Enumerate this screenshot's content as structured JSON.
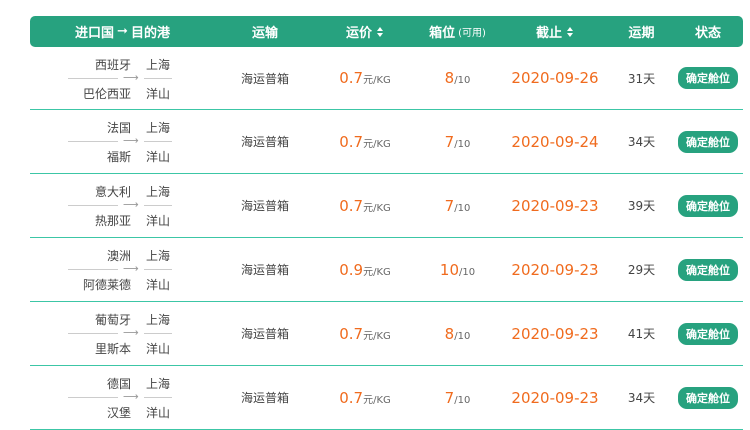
{
  "header": {
    "route_label": "进口国",
    "route_arrow": "➞",
    "route_dest": "目的港",
    "transport": "运输",
    "price": "运价",
    "box": "箱位",
    "box_note": "(可用)",
    "deadline": "截止",
    "days": "运期",
    "status": "状态"
  },
  "rows": [
    {
      "origin_country": "西班牙",
      "origin_port": "巴伦西亚",
      "dest_city": "上海",
      "dest_port": "洋山",
      "transport": "海运普箱",
      "price": "0.7",
      "price_unit": "元/KG",
      "box_avail": "8",
      "box_total": "/10",
      "deadline": "2020-09-26",
      "days": "31天",
      "action": "确定舱位"
    },
    {
      "origin_country": "法国",
      "origin_port": "福斯",
      "dest_city": "上海",
      "dest_port": "洋山",
      "transport": "海运普箱",
      "price": "0.7",
      "price_unit": "元/KG",
      "box_avail": "7",
      "box_total": "/10",
      "deadline": "2020-09-24",
      "days": "34天",
      "action": "确定舱位"
    },
    {
      "origin_country": "意大利",
      "origin_port": "热那亚",
      "dest_city": "上海",
      "dest_port": "洋山",
      "transport": "海运普箱",
      "price": "0.7",
      "price_unit": "元/KG",
      "box_avail": "7",
      "box_total": "/10",
      "deadline": "2020-09-23",
      "days": "39天",
      "action": "确定舱位"
    },
    {
      "origin_country": "澳洲",
      "origin_port": "阿德莱德",
      "dest_city": "上海",
      "dest_port": "洋山",
      "transport": "海运普箱",
      "price": "0.9",
      "price_unit": "元/KG",
      "box_avail": "10",
      "box_total": "/10",
      "deadline": "2020-09-23",
      "days": "29天",
      "action": "确定舱位"
    },
    {
      "origin_country": "葡萄牙",
      "origin_port": "里斯本",
      "dest_city": "上海",
      "dest_port": "洋山",
      "transport": "海运普箱",
      "price": "0.7",
      "price_unit": "元/KG",
      "box_avail": "8",
      "box_total": "/10",
      "deadline": "2020-09-23",
      "days": "41天",
      "action": "确定舱位"
    },
    {
      "origin_country": "德国",
      "origin_port": "汉堡",
      "dest_city": "上海",
      "dest_port": "洋山",
      "transport": "海运普箱",
      "price": "0.7",
      "price_unit": "元/KG",
      "box_avail": "7",
      "box_total": "/10",
      "deadline": "2020-09-23",
      "days": "34天",
      "action": "确定舱位"
    }
  ],
  "icons": {
    "sort": "sort-icon",
    "route_arrow": "arrow-right-icon"
  },
  "colors": {
    "header_bg": "#27a27f",
    "accent_orange": "#f06b1e",
    "row_border": "#3cc6a6"
  }
}
